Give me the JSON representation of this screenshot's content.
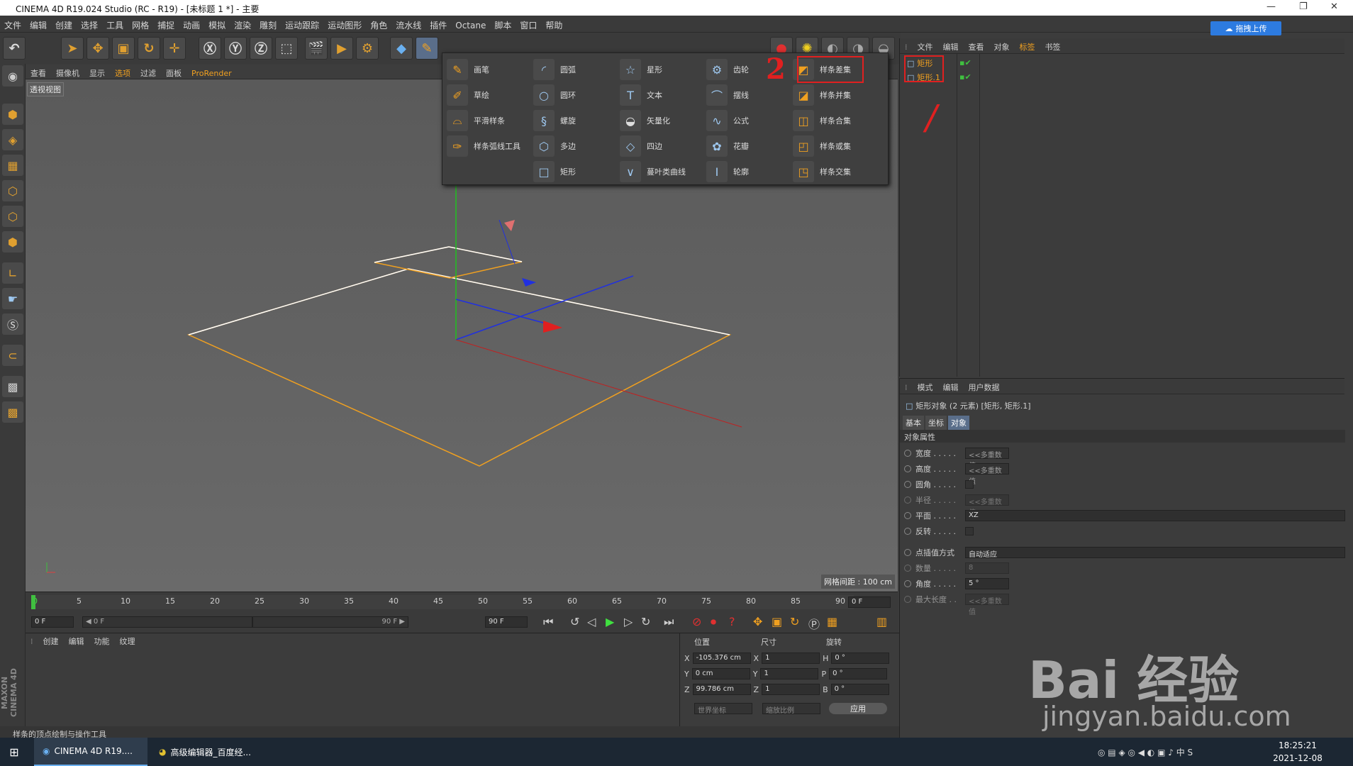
{
  "window": {
    "title": "CINEMA 4D R19.024 Studio (RC - R19) - [未标题 1 *] - 主要"
  },
  "menubar": [
    "文件",
    "编辑",
    "创建",
    "选择",
    "工具",
    "网格",
    "捕捉",
    "动画",
    "模拟",
    "渲染",
    "雕刻",
    "运动跟踪",
    "运动图形",
    "角色",
    "流水线",
    "插件",
    "Octane",
    "脚本",
    "窗口",
    "帮助"
  ],
  "viewport": {
    "menu": [
      "查看",
      "摄像机",
      "显示",
      "选项",
      "过滤",
      "面板",
      "ProRender"
    ],
    "label": "透视视图",
    "grid_info": "网格间距 : 100 cm"
  },
  "popup": {
    "col1": [
      "画笔",
      "草绘",
      "平滑样条",
      "样条弧线工具"
    ],
    "col2": [
      "圆弧",
      "圆环",
      "螺旋",
      "多边",
      "矩形"
    ],
    "col3": [
      "星形",
      "文本",
      "矢量化",
      "四边",
      "蔓叶类曲线"
    ],
    "col4": [
      "齿轮",
      "摆线",
      "公式",
      "花瓣",
      "轮廓"
    ],
    "col5": [
      "样条差集",
      "样条并集",
      "样条合集",
      "样条或集",
      "样条交集"
    ]
  },
  "annotations": {
    "one": "/",
    "two": "2"
  },
  "object_manager": {
    "menu": [
      "文件",
      "编辑",
      "查看",
      "对象",
      "标签",
      "书签"
    ],
    "objects": [
      "矩形",
      "矩形.1"
    ],
    "upload_button": "拖拽上传"
  },
  "attributes": {
    "menu": [
      "模式",
      "编辑",
      "用户数据"
    ],
    "header": "矩形对象 (2 元素) [矩形, 矩形.1]",
    "tabs": [
      "基本",
      "坐标",
      "对象"
    ],
    "section": "对象属性",
    "props": [
      {
        "label": "宽度 . . . . .",
        "value": "<<多重数值"
      },
      {
        "label": "高度 . . . . .",
        "value": "<<多重数值"
      },
      {
        "label": "圆角 . . . . .",
        "value": ""
      },
      {
        "label": "半径 . . . . .",
        "value": "<<多重数值"
      },
      {
        "label": "平面 . . . . .",
        "value": "XZ"
      },
      {
        "label": "反转 . . . . .",
        "value": ""
      },
      {
        "label": "点插值方式",
        "value": "自动适应"
      },
      {
        "label": "数量 . . . . .",
        "value": "8"
      },
      {
        "label": "角度 . . . . .",
        "value": "5 °"
      },
      {
        "label": "最大长度 . .",
        "value": "<<多重数值"
      }
    ]
  },
  "timeline": {
    "ticks": [
      "0",
      "5",
      "10",
      "15",
      "20",
      "25",
      "30",
      "35",
      "40",
      "45",
      "50",
      "55",
      "60",
      "65",
      "70",
      "75",
      "80",
      "85",
      "90"
    ],
    "current": "0 F",
    "start": "0 F",
    "range_start": "◀ 0 F",
    "range_end": "90 F ▶",
    "end": "90 F",
    "end2": "90 F"
  },
  "bottom": {
    "menu": [
      "创建",
      "编辑",
      "功能",
      "纹理"
    ]
  },
  "coords": {
    "headers": [
      "位置",
      "尺寸",
      "旋转"
    ],
    "rows": [
      {
        "a": "X",
        "v1": "-105.376 cm",
        "b": "X",
        "v2": "1",
        "c": "H",
        "v3": "0 °"
      },
      {
        "a": "Y",
        "v1": "0 cm",
        "b": "Y",
        "v2": "1",
        "c": "P",
        "v3": "0 °"
      },
      {
        "a": "Z",
        "v1": "99.786 cm",
        "b": "Z",
        "v2": "1",
        "c": "B",
        "v3": "0 °"
      }
    ],
    "world": "世界坐标",
    "scale": "缩放比例",
    "apply": "应用"
  },
  "statusbar": "样条的顶点绘制与操作工具",
  "taskbar": {
    "task1": "CINEMA 4D R19....",
    "task2": "高级编辑器_百度经...",
    "time": "18:25:21",
    "date": "2021-12-08"
  },
  "watermark": {
    "brand": "Bai 经验",
    "url": "jingyan.baidu.com"
  },
  "colors": {
    "accent": "#f0a020",
    "highlight_red": "#e02020",
    "bg": "#3c3c3c"
  }
}
